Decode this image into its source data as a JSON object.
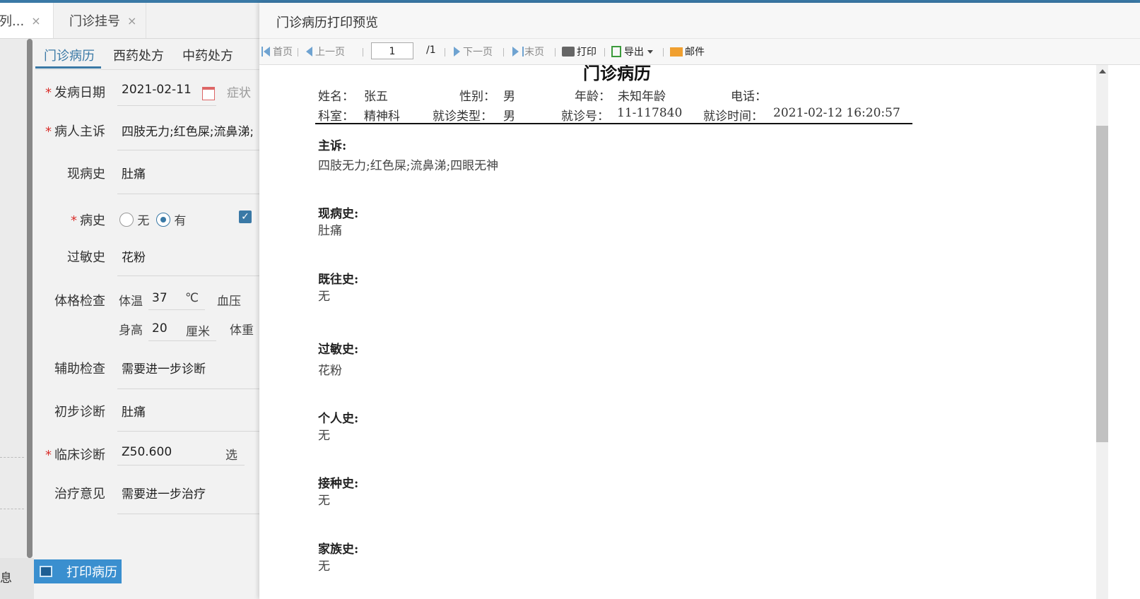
{
  "tabs": [
    {
      "label": "(列...",
      "close": "×"
    },
    {
      "label": "门诊挂号",
      "close": "×"
    }
  ],
  "left_edge_text": "息",
  "form": {
    "subtabs": [
      "门诊病历",
      "西药处方",
      "中药处方"
    ],
    "onset_date": {
      "label": "发病日期",
      "value": "2021-02-11",
      "next_label": "症状"
    },
    "chief_complaint": {
      "label": "病人主诉",
      "value": "四肢无力;红色屎;流鼻涕;"
    },
    "present_illness": {
      "label": "现病史",
      "value": "肚痛"
    },
    "history": {
      "label": "病史",
      "opt_no": "无",
      "opt_yes": "有"
    },
    "allergy": {
      "label": "过敏史",
      "value": "花粉"
    },
    "physical": {
      "label": "体格检查",
      "temp_label": "体温",
      "temp_value": "37",
      "temp_unit": "℃",
      "bp_label": "血压",
      "height_label": "身高",
      "height_value": "20",
      "height_unit": "厘米",
      "weight_label": "体重"
    },
    "aux_exam": {
      "label": "辅助检查",
      "value": "需要进一步诊断"
    },
    "prelim_diag": {
      "label": "初步诊断",
      "value": "肚痛"
    },
    "clinical_diag": {
      "label": "临床诊断",
      "value": "Z50.600",
      "select": "选"
    },
    "treatment": {
      "label": "治疗意见",
      "value": "需要进一步治疗"
    },
    "print_button": "打印病历"
  },
  "dialog": {
    "title": "门诊病历打印预览",
    "toolbar": {
      "first": "首页",
      "prev": "上一页",
      "page_value": "1",
      "page_total": "/1",
      "next": "下一页",
      "last": "末页",
      "print": "打印",
      "export": "导出",
      "mail": "邮件"
    },
    "doc": {
      "title": "门诊病历",
      "name_label": "姓名：",
      "name": "张五",
      "gender_label": "性别：",
      "gender": "男",
      "age_label": "年龄：",
      "age": "未知年龄",
      "phone_label": "电话：",
      "dept_label": "科室：",
      "dept": "精神科",
      "visit_type_label": "就诊类型：",
      "visit_type": "男",
      "visit_no_label": "就诊号：",
      "visit_no": "11-117840",
      "visit_time_label": "就诊时间：",
      "visit_time": "2021-02-12 16:20:57",
      "sections": [
        {
          "heading": "主诉:",
          "value": "四肢无力;红色屎;流鼻涕;四眼无神"
        },
        {
          "heading": "现病史:",
          "value": "肚痛"
        },
        {
          "heading": "既往史:",
          "value": "无"
        },
        {
          "heading": "过敏史:",
          "value": "花粉"
        },
        {
          "heading": "个人史:",
          "value": "无"
        },
        {
          "heading": "接种史:",
          "value": "无"
        },
        {
          "heading": "家族史:",
          "value": "无"
        }
      ]
    }
  }
}
